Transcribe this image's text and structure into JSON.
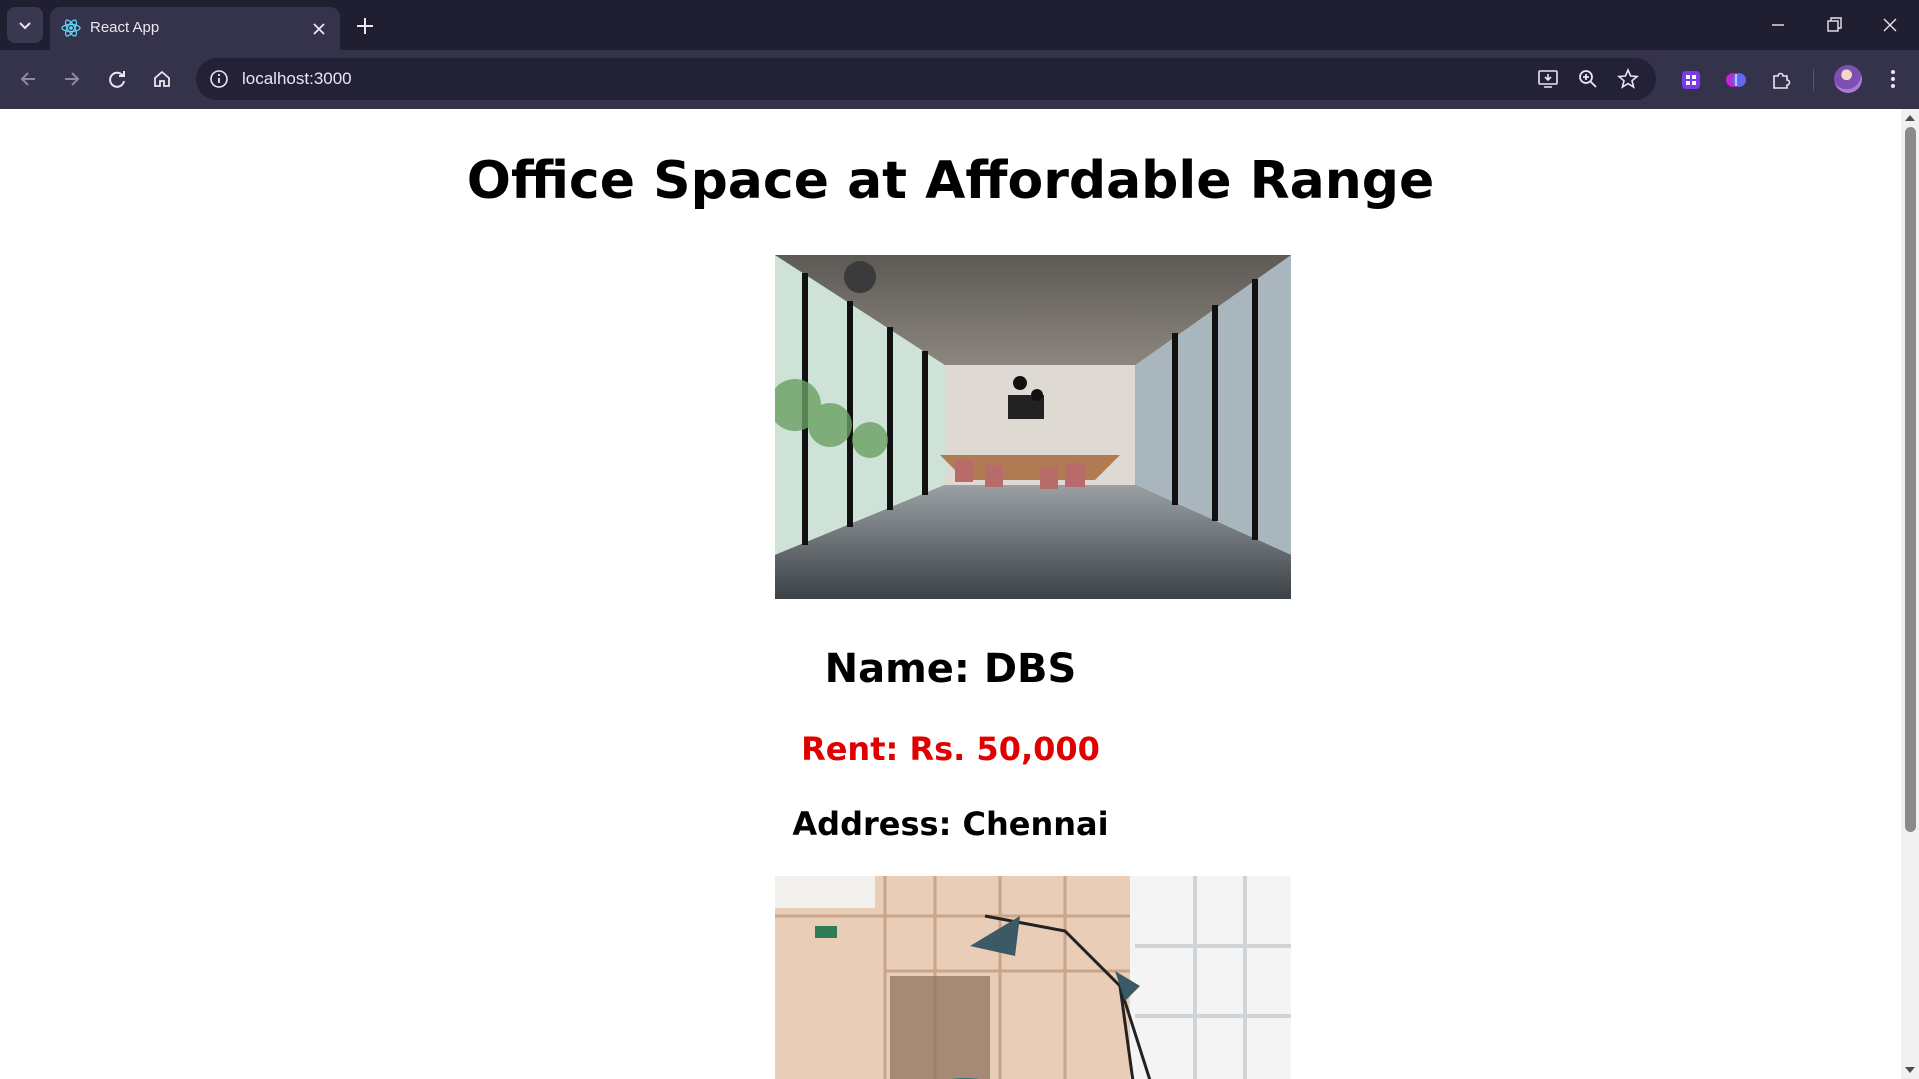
{
  "browser": {
    "tab": {
      "title": "React App",
      "favicon": "react-icon"
    },
    "url": "localhost:3000",
    "icons": [
      "tab-search-icon",
      "close-icon",
      "plus-icon",
      "minimize-icon",
      "restore-icon",
      "window-close-icon",
      "back-arrow-icon",
      "forward-arrow-icon",
      "reload-icon",
      "home-icon",
      "site-info-icon",
      "install-app-icon",
      "zoom-icon",
      "bookmark-star-icon",
      "extension-purple-icon",
      "extension-brain-icon",
      "puzzle-icon",
      "avatar",
      "kebab-menu-icon"
    ]
  },
  "page": {
    "title": "Office Space at Affordable Range",
    "offices": [
      {
        "name": "Name: DBS",
        "rent": "Rent: Rs. 50,000",
        "address": "Address: Chennai",
        "image": "office-interior-photo"
      }
    ],
    "second_image": "office-interior-photo-2"
  },
  "colors": {
    "rent": "#e00000",
    "chrome_dark": "#201e31",
    "chrome_toolbar": "#35334b"
  }
}
